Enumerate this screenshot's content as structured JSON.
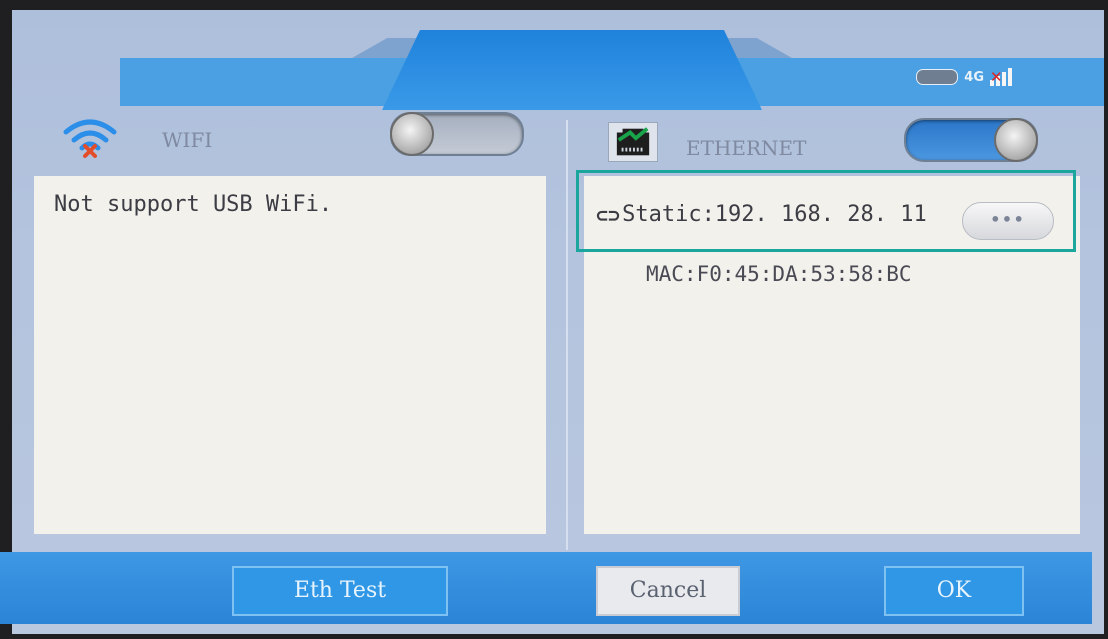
{
  "status": {
    "network_label": "4G",
    "battery_icon": "battery-icon",
    "signal_icon": "signal-no-service-icon"
  },
  "wifi": {
    "label": "WIFI",
    "icon": "wifi-disabled-icon",
    "toggle_state": "off",
    "message": "Not support USB WiFi."
  },
  "ethernet": {
    "label": "ETHERNET",
    "icon": "ethernet-port-icon",
    "toggle_state": "on",
    "link_icon": "link-icon",
    "ip_text": "Static:192. 168. 28. 11",
    "more_label": "•••",
    "mac_text": "MAC:F0:45:DA:53:58:BC",
    "highlight_color": "#1aa59d"
  },
  "footer": {
    "eth_test_label": "Eth Test",
    "cancel_label": "Cancel",
    "ok_label": "OK"
  },
  "colors": {
    "accent_blue": "#2f97e6",
    "panel_bg": "#f2f1ec"
  }
}
